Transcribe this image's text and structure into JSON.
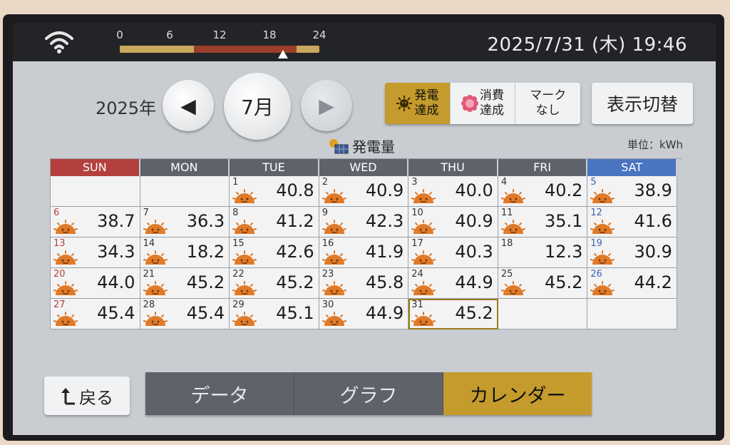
{
  "status_bar": {
    "wifi_icon": "wifi-icon",
    "time_scale": [
      "0",
      "6",
      "12",
      "18",
      "24"
    ],
    "current_hour": 19.77,
    "datetime": "2025/7/31 (木) 19:46"
  },
  "nav": {
    "year": "2025年",
    "prev": "◀",
    "month": "7月",
    "next": "▶"
  },
  "marks": [
    {
      "line1": "発電",
      "line2": "達成",
      "icon": "sun-face-icon",
      "active": true
    },
    {
      "line1": "消費",
      "line2": "達成",
      "icon": "flower-icon",
      "active": false
    },
    {
      "line1": "マーク",
      "line2": "なし",
      "icon": "",
      "active": false
    }
  ],
  "toggle_label": "表示切替",
  "caption": "発電量",
  "unit": "単位：kWh",
  "weekdays": [
    "SUN",
    "MON",
    "TUE",
    "WED",
    "THU",
    "FRI",
    "SAT"
  ],
  "weeks": [
    [
      null,
      null,
      {
        "day": "1",
        "value": "40.8"
      },
      {
        "day": "2",
        "value": "40.9"
      },
      {
        "day": "3",
        "value": "40.0"
      },
      {
        "day": "4",
        "value": "40.2"
      },
      {
        "day": "5",
        "value": "38.9"
      }
    ],
    [
      {
        "day": "6",
        "value": "38.7"
      },
      {
        "day": "7",
        "value": "36.3"
      },
      {
        "day": "8",
        "value": "41.2"
      },
      {
        "day": "9",
        "value": "42.3"
      },
      {
        "day": "10",
        "value": "40.9"
      },
      {
        "day": "11",
        "value": "35.1"
      },
      {
        "day": "12",
        "value": "41.6"
      }
    ],
    [
      {
        "day": "13",
        "value": "34.3"
      },
      {
        "day": "14",
        "value": "18.2"
      },
      {
        "day": "15",
        "value": "42.6"
      },
      {
        "day": "16",
        "value": "41.9"
      },
      {
        "day": "17",
        "value": "40.3"
      },
      {
        "day": "18",
        "value": "12.3",
        "noicon": true
      },
      {
        "day": "19",
        "value": "30.9"
      }
    ],
    [
      {
        "day": "20",
        "value": "44.0"
      },
      {
        "day": "21",
        "value": "45.2"
      },
      {
        "day": "22",
        "value": "45.2"
      },
      {
        "day": "23",
        "value": "45.8"
      },
      {
        "day": "24",
        "value": "44.9"
      },
      {
        "day": "25",
        "value": "45.2"
      },
      {
        "day": "26",
        "value": "44.2"
      }
    ],
    [
      {
        "day": "27",
        "value": "45.4"
      },
      {
        "day": "28",
        "value": "45.4"
      },
      {
        "day": "29",
        "value": "45.1"
      },
      {
        "day": "30",
        "value": "44.9"
      },
      {
        "day": "31",
        "value": "45.2",
        "today": true
      },
      null,
      null
    ]
  ],
  "back_label": "戻る",
  "tabs": [
    {
      "label": "データ",
      "active": false
    },
    {
      "label": "グラフ",
      "active": false
    },
    {
      "label": "カレンダー",
      "active": true
    }
  ],
  "colors": {
    "accent_gold": "#c49b2c",
    "sunday_red": "#b3403d",
    "saturday_blue": "#4a74c0",
    "header_gray": "#5e636b"
  }
}
